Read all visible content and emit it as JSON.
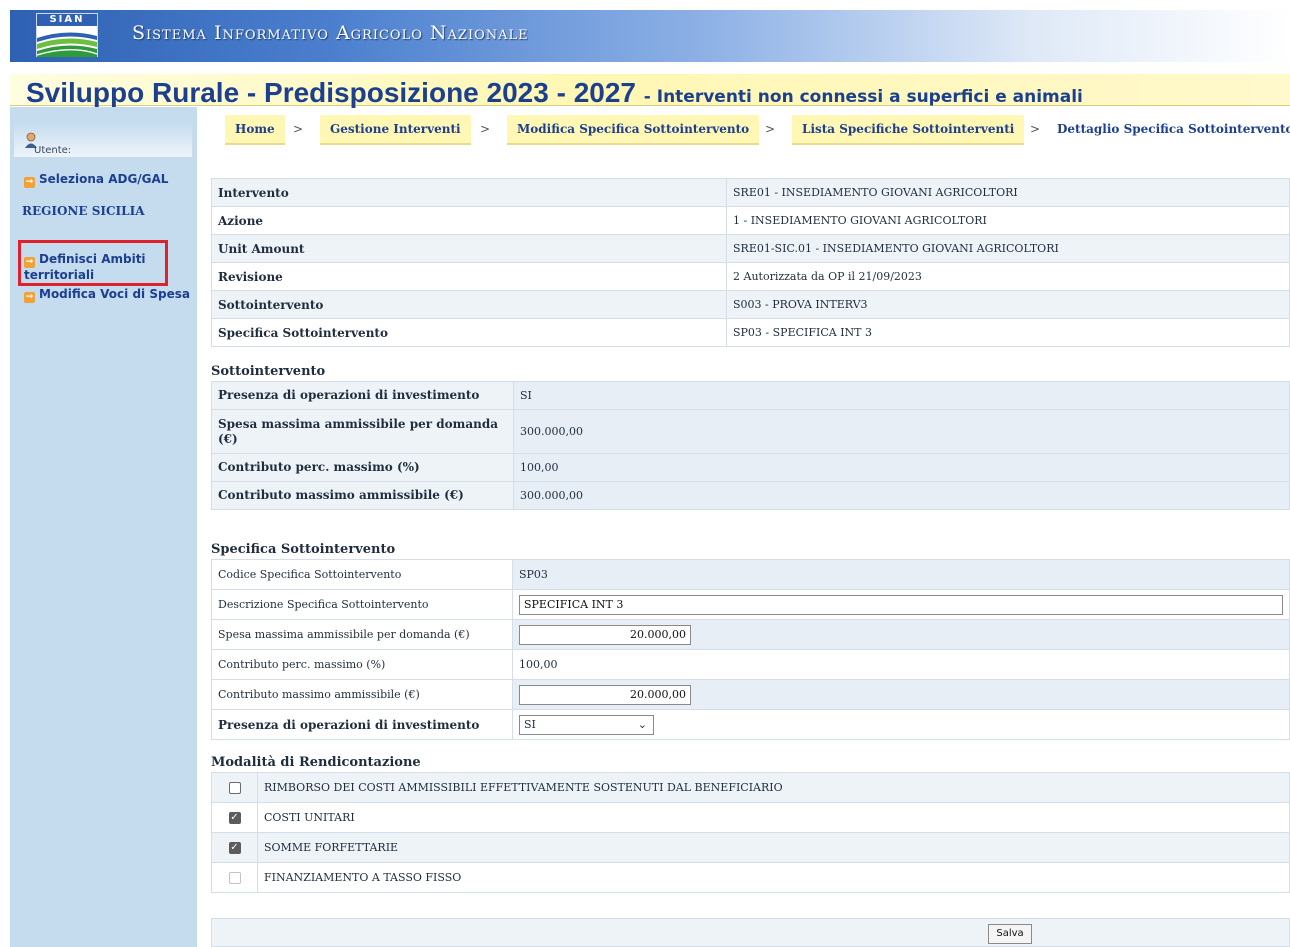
{
  "header": {
    "logo_text": "SIAN",
    "system_title": "Sistema Informativo Agricolo Nazionale",
    "main_title": "Sviluppo Rurale - Predisposizione 2023 - 2027",
    "main_subtitle": "- Interventi non connessi a superfici e animali"
  },
  "sidebar": {
    "user_label": "Utente:",
    "select_link": "Seleziona ADG/GAL",
    "region": "REGIONE SICILIA",
    "link_ambiti": "Definisci Ambiti territoriali",
    "link_voci": "Modifica Voci di Spesa"
  },
  "breadcrumb": {
    "items": [
      "Home",
      "Gestione Interventi",
      "Modifica Specifica Sottointervento",
      "Lista Specifiche Sottointerventi"
    ],
    "current": "Dettaglio Specifica Sottointervento",
    "separator": ">"
  },
  "info": {
    "rows": [
      {
        "label": "Intervento",
        "value": "SRE01 - INSEDIAMENTO GIOVANI AGRICOLTORI"
      },
      {
        "label": "Azione",
        "value": "1 - INSEDIAMENTO GIOVANI AGRICOLTORI"
      },
      {
        "label": "Unit Amount",
        "value": "SRE01-SIC.01 - INSEDIAMENTO GIOVANI AGRICOLTORI"
      },
      {
        "label": "Revisione",
        "value": "2 Autorizzata da OP il 21/09/2023"
      },
      {
        "label": "Sottointervento",
        "value": "S003 - PROVA INTERV3"
      },
      {
        "label": "Specifica Sottointervento",
        "value": "SP03 - SPECIFICA INT 3"
      }
    ]
  },
  "sottointervento": {
    "title": "Sottointervento",
    "rows": [
      {
        "label": "Presenza di operazioni di investimento",
        "value": "SI"
      },
      {
        "label": "Spesa massima ammissibile per domanda (€)",
        "value": "300.000,00"
      },
      {
        "label": "Contributo perc. massimo (%)",
        "value": "100,00"
      },
      {
        "label": "Contributo massimo ammissibile (€)",
        "value": "300.000,00"
      }
    ]
  },
  "specifica": {
    "title": "Specifica Sottointervento",
    "codice_label": "Codice Specifica Sottointervento",
    "codice_value": "SP03",
    "descrizione_label": "Descrizione Specifica Sottointervento",
    "descrizione_value": "SPECIFICA INT 3",
    "spesa_label": "Spesa massima ammissibile per domanda (€)",
    "spesa_value": "20.000,00",
    "contributo_perc_label": "Contributo perc. massimo (%)",
    "contributo_perc_value": "100,00",
    "contributo_max_label": "Contributo massimo ammissibile (€)",
    "contributo_max_value": "20.000,00",
    "investimento_label": "Presenza di operazioni di investimento",
    "investimento_value": "SI"
  },
  "modalita": {
    "title": "Modalità di Rendicontazione",
    "items": [
      {
        "label": "RIMBORSO DEI COSTI AMMISSIBILI EFFETTIVAMENTE SOSTENUTI DAL BENEFICIARIO",
        "checked": false
      },
      {
        "label": "COSTI UNITARI",
        "checked": true
      },
      {
        "label": "SOMME FORFETTARIE",
        "checked": true
      },
      {
        "label": "FINANZIAMENTO A TASSO FISSO",
        "checked": false
      }
    ]
  },
  "actions": {
    "save_label": "Salva"
  }
}
